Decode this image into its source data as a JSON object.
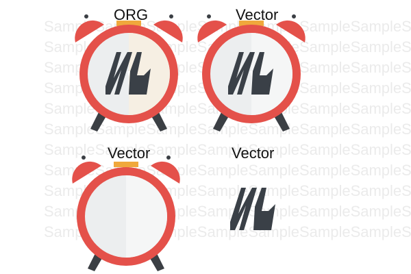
{
  "watermark": {
    "text": "SampleSampleSampleSampleSampleSampleSampleSample"
  },
  "panels": [
    {
      "label": "ORG",
      "content": "alarm-clock-with-logo"
    },
    {
      "label": "Vector",
      "content": "alarm-clock-with-logo"
    },
    {
      "label": "Vector",
      "content": "alarm-clock-empty"
    },
    {
      "label": "Vector",
      "content": "logo-only"
    }
  ],
  "colors": {
    "clock_red": "#e4514a",
    "clock_dark_red": "#c73e38",
    "bell_accent": "#f0a83c",
    "face": "#eceeef",
    "face_shade": "#f5f6f6",
    "legs": "#3b3f44",
    "logo": "#3a4047",
    "hand": "#ffffff"
  }
}
